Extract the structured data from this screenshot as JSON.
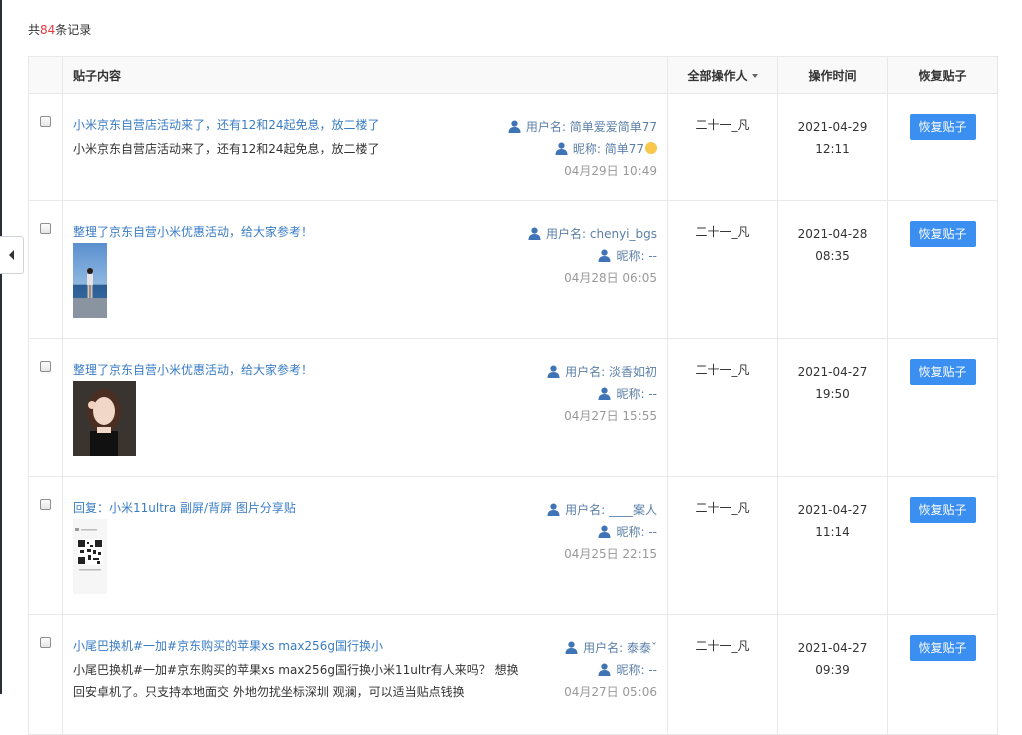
{
  "summary": {
    "prefix": "共",
    "count": "84",
    "suffix": "条记录"
  },
  "table": {
    "headers": {
      "content": "贴子内容",
      "operator": "全部操作人",
      "time": "操作时间",
      "action": "恢复贴子"
    },
    "labels": {
      "username_prefix": "用户名: ",
      "nickname_prefix": "昵称: "
    },
    "rows": [
      {
        "title": "小米京东自营店活动来了，还有12和24起免息，放二楼了",
        "body": "小米京东自营店活动来了，还有12和24起免息，放二楼了",
        "image": "",
        "username": "简单爱爱简单77",
        "nickname": "简单77",
        "post_time": "04月29日 10:49",
        "operator": "二十一_凡",
        "op_date": "2021-04-29",
        "op_time": "12:11",
        "action": "恢复贴子"
      },
      {
        "title": "整理了京东自营小米优惠活动，给大家参考！",
        "body": "",
        "image": "beach-photo",
        "username": "chenyi_bgs",
        "nickname": "--",
        "post_time": "04月28日 06:05",
        "operator": "二十一_凡",
        "op_date": "2021-04-28",
        "op_time": "08:35",
        "action": "恢复贴子"
      },
      {
        "title": "整理了京东自营小米优惠活动，给大家参考！",
        "body": "",
        "image": "selfie-photo",
        "username": "淡香如初",
        "nickname": "--",
        "post_time": "04月27日 15:55",
        "operator": "二十一_凡",
        "op_date": "2021-04-27",
        "op_time": "19:50",
        "action": "恢复贴子"
      },
      {
        "title": "回复：小米11ultra 副屏/背屏 图片分享贴",
        "body": "",
        "image": "qr-screenshot",
        "username": "____案人",
        "nickname": "--",
        "post_time": "04月25日 22:15",
        "operator": "二十一_凡",
        "op_date": "2021-04-27",
        "op_time": "11:14",
        "action": "恢复贴子"
      },
      {
        "title": "小尾巴换机#一加#京东购买的苹果xs max256g国行换小",
        "body": "小尾巴换机#一加#京东购买的苹果xs max256g国行换小米11ultr有人来吗？ 想换回安卓机了。只支持本地面交 外地勿扰坐标深圳 观澜，可以适当贴点钱换",
        "image": "",
        "username": "泰泰ˇ",
        "nickname": "--",
        "post_time": "04月27日 05:06",
        "operator": "二十一_凡",
        "op_date": "2021-04-27",
        "op_time": "09:39",
        "action": "恢复贴子"
      }
    ]
  },
  "icons": {
    "user": "user-icon",
    "collapse": "chevron-left-icon",
    "checkbox": "checkbox"
  },
  "colors": {
    "link": "#3a7cc4",
    "button": "#3b8ff0",
    "count": "#e4393c"
  }
}
